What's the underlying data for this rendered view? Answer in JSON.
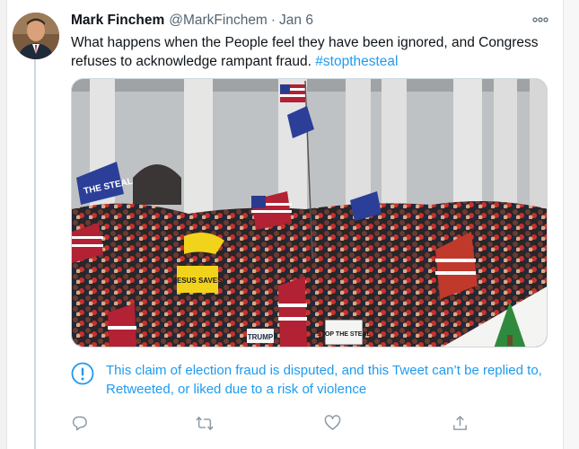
{
  "tweet": {
    "author_name": "Mark Finchem",
    "author_handle": "@MarkFinchem",
    "separator": "·",
    "date": "Jan 6",
    "text": "What happens when the People feel they have been ignored, and Congress refuses to acknowledge rampant fraud.",
    "hashtag": "#stopthesteal"
  },
  "media": {
    "sign_stop_the_steal": "STOP THE STEAL",
    "sign_jesus_saves": "JESUS SAVES",
    "banner_the_steal": "THE STEAL",
    "sign_trump": "TRUMP"
  },
  "notice": {
    "icon": "exclamation-circle-icon",
    "text": "This claim of election fraud is disputed, and this Tweet can’t be replied to, Retweeted, or liked due to a risk of violence"
  },
  "actions": {
    "icons": [
      "reply-icon",
      "retweet-icon",
      "like-icon",
      "share-icon"
    ]
  },
  "colors": {
    "accent": "#1d9bf0",
    "secondary_text": "#536471",
    "icon_gray": "#8b98a5"
  }
}
